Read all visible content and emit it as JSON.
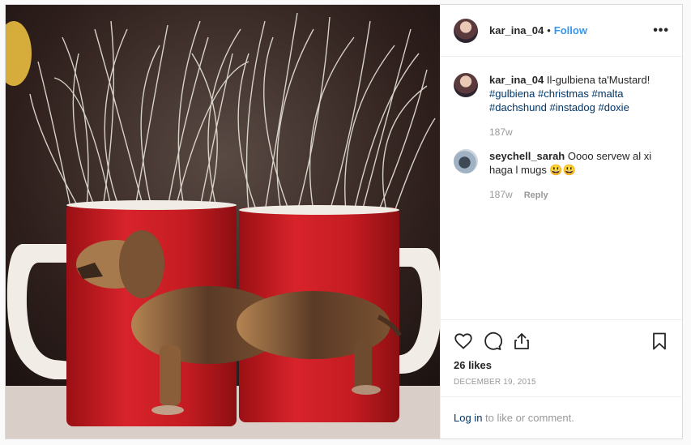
{
  "post": {
    "author": "kar_ina_04",
    "separator": "•",
    "follow_label": "Follow",
    "more_label": "•••",
    "image_alt": "Two red mugs printed with a dachshund, filled with dry grass"
  },
  "caption": {
    "username": "kar_ina_04",
    "text": "Il-gulbiena ta'Mustard!",
    "hashtags": [
      "#gulbiena",
      "#christmas",
      "#malta",
      "#dachshund",
      "#instadog",
      "#doxie"
    ],
    "time": "187w"
  },
  "comments": [
    {
      "username": "seychell_sarah",
      "text": "Oooo servew al xi haga l mugs 😃😃",
      "time": "187w",
      "reply_label": "Reply"
    }
  ],
  "actions": {
    "likes": "26 likes",
    "date": "DECEMBER 19, 2015"
  },
  "login": {
    "link": "Log in",
    "rest": " to like or comment."
  },
  "colors": {
    "accent": "#3897f0",
    "hashtag": "#003569",
    "muted": "#999999"
  },
  "icons": {
    "like": "heart-icon",
    "comment": "speech-bubble-icon",
    "share": "share-icon",
    "save": "bookmark-icon",
    "more": "ellipsis-icon"
  }
}
